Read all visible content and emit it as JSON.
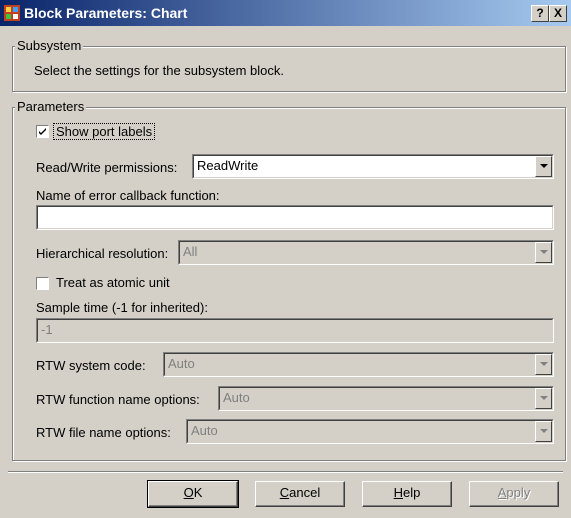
{
  "window": {
    "title": "Block Parameters: Chart",
    "help_btn": "?",
    "close_btn": "X"
  },
  "subsystem": {
    "legend": "Subsystem",
    "description": "Select the settings for the subsystem block."
  },
  "parameters": {
    "legend": "Parameters",
    "show_port_labels": {
      "label": "Show port labels",
      "checked": true
    },
    "rw_permissions": {
      "label": "Read/Write permissions:",
      "value": "ReadWrite"
    },
    "error_callback": {
      "label": "Name of error callback function:",
      "value": ""
    },
    "hier_resolution": {
      "label": "Hierarchical resolution:",
      "value": "All"
    },
    "atomic_unit": {
      "label": "Treat as atomic unit",
      "checked": false
    },
    "sample_time": {
      "label": "Sample time (-1 for inherited):",
      "value": "-1"
    },
    "rtw_system_code": {
      "label": "RTW system code:",
      "value": "Auto"
    },
    "rtw_function_name": {
      "label": "RTW function name options:",
      "value": "Auto"
    },
    "rtw_file_name": {
      "label": "RTW file name options:",
      "value": "Auto"
    }
  },
  "buttons": {
    "ok": {
      "mnemonic": "O",
      "rest": "K"
    },
    "cancel": {
      "mnemonic": "C",
      "rest": "ancel"
    },
    "help": {
      "mnemonic": "H",
      "rest": "elp"
    },
    "apply": {
      "mnemonic": "A",
      "rest": "pply"
    }
  }
}
